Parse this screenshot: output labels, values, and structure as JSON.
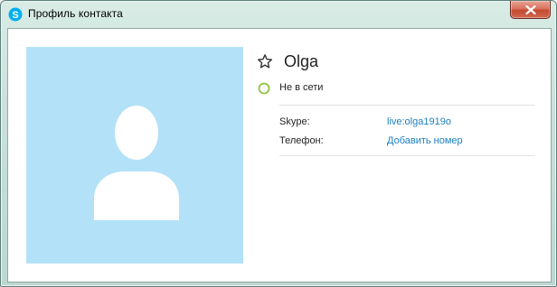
{
  "window": {
    "title": "Профиль контакта",
    "title_icon": "skype-icon",
    "close_icon": "close-icon"
  },
  "profile": {
    "avatar_icon": "default-avatar-icon",
    "favorite_icon": "star-outline-icon",
    "name": "Olga",
    "status_icon": "offline-status-icon",
    "status": "Не в сети"
  },
  "details": [
    {
      "label": "Skype:",
      "value": "live:olga1919o"
    },
    {
      "label": "Телефон:",
      "value": "Добавить номер"
    }
  ],
  "colors": {
    "avatar_background": "#b3e2f8",
    "link": "#1a7fc0",
    "offline_status": "#8cc63f",
    "skype_brand": "#00aff0",
    "close_button": "#c44a31"
  }
}
